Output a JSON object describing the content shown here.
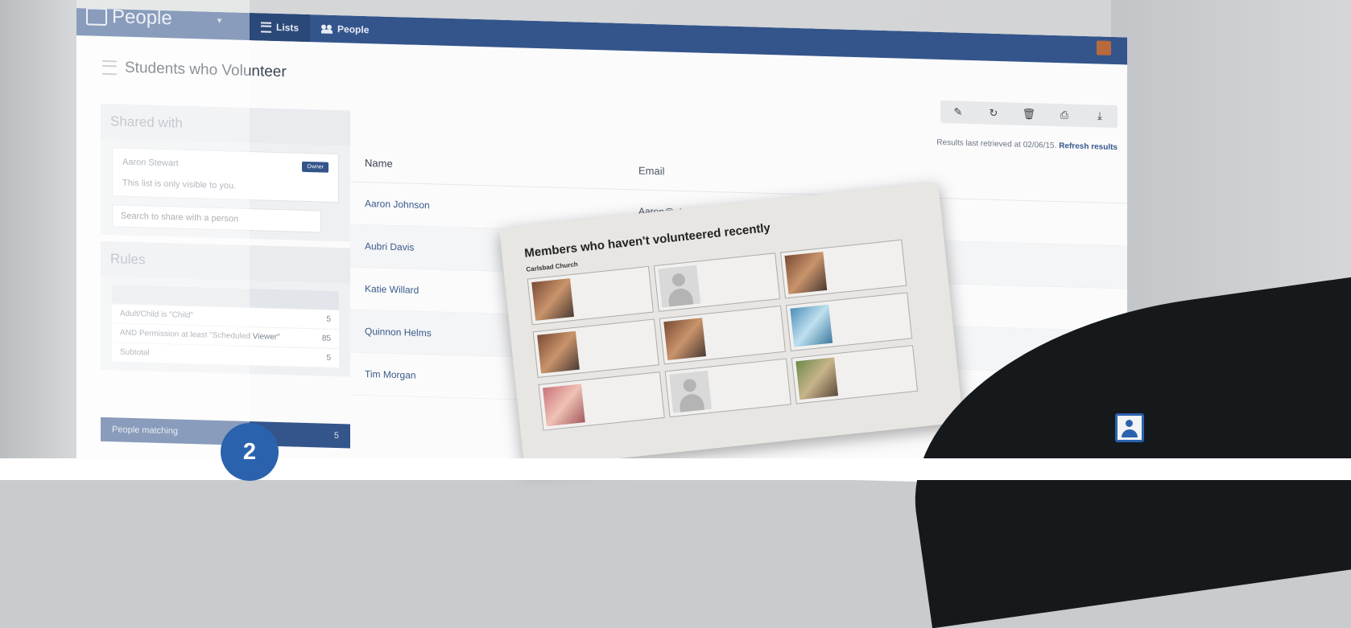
{
  "app": {
    "brand": "People"
  },
  "nav": [
    {
      "label": "Lists",
      "icon": "list-icon"
    },
    {
      "label": "People",
      "icon": "people-icon"
    }
  ],
  "page": {
    "title": "Students who Volunteer"
  },
  "toolbar": [
    {
      "icon": "edit-icon",
      "glyph": "✎"
    },
    {
      "icon": "refresh-icon",
      "glyph": "↻"
    },
    {
      "icon": "trash-icon",
      "glyph": "🗑"
    },
    {
      "icon": "print-icon",
      "glyph": "⎙"
    },
    {
      "icon": "download-icon",
      "glyph": "⤓"
    }
  ],
  "shared": {
    "heading": "Shared with",
    "owner_name": "Aaron Stewart",
    "owner_badge": "Owner",
    "note": "This list is only visible to you.",
    "search_placeholder": "Search to share with a person"
  },
  "rules": {
    "heading": "Rules",
    "rows": [
      {
        "label": "Adult/Child is \"Child\"",
        "count": "5"
      },
      {
        "label": "AND Permission at least \"Scheduled Viewer\"",
        "count": "85"
      },
      {
        "label": "Subtotal",
        "count": "5"
      }
    ]
  },
  "matching": {
    "label": "People matching",
    "count": "5"
  },
  "results": {
    "retrieved": "Results last retrieved at 02/06/15.",
    "refresh_link": "Refresh results"
  },
  "table": {
    "headers": [
      "Name",
      "Email"
    ],
    "rows": [
      {
        "name": "Aaron Johnson",
        "email": "Aaron@planningcenteronline.net"
      },
      {
        "name": "Aubri Davis",
        "email": ""
      },
      {
        "name": "Katie Willard",
        "email": ""
      },
      {
        "name": "Quinnon Helms",
        "email": ""
      },
      {
        "name": "Tim Morgan",
        "email": ""
      }
    ]
  },
  "paper": {
    "title": "Members who haven't volunteered recently",
    "subtitle": "Carlsbad Church"
  },
  "overlay": {
    "step": "2"
  },
  "colors": {
    "brand_blue": "#34558b",
    "badge_blue": "#2b62ad"
  }
}
